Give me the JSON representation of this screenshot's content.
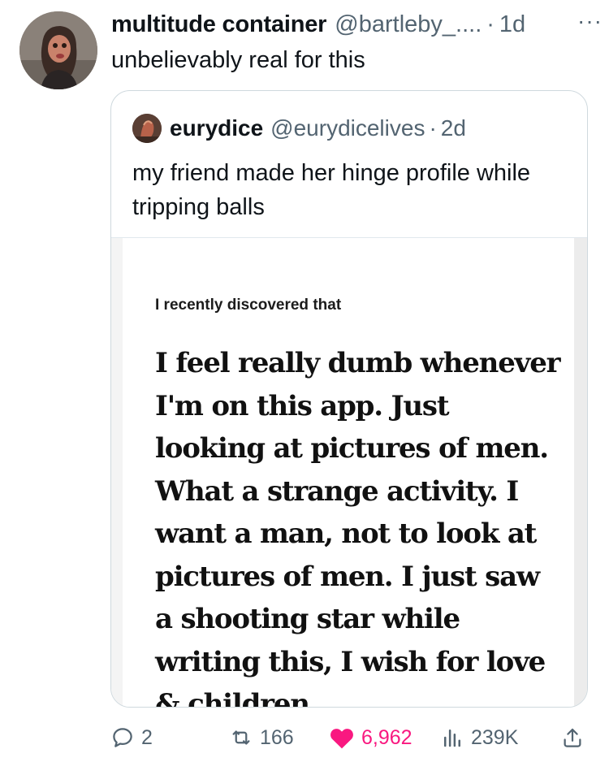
{
  "tweet": {
    "author_name": "multitude container",
    "handle": "@bartleby_....",
    "separator": "·",
    "time": "1d",
    "more_icon": "···",
    "text": "unbelievably real for this"
  },
  "quote": {
    "author_name": "eurydice",
    "handle": "@eurydicelives",
    "separator": "·",
    "time": "2d",
    "text": "my friend made her hinge profile while tripping balls",
    "media": {
      "prompt": "I recently discovered that",
      "answer": "I feel really dumb whenever I'm on this app. Just looking at pictures of men. What a strange activity. I want a man, not to look at pictures of men. I just saw a shooting star while writing this, I wish for love & children"
    }
  },
  "actions": {
    "replies": "2",
    "reposts": "166",
    "likes": "6,962",
    "views": "239K"
  },
  "colors": {
    "like": "#f91880",
    "secondary_text": "#536471",
    "border": "#cfd9de"
  }
}
